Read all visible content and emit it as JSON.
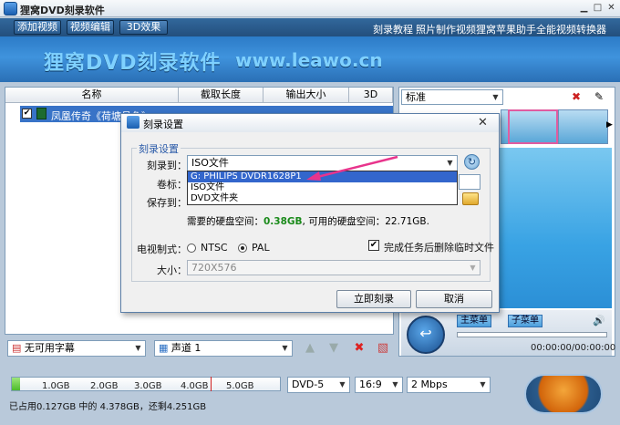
{
  "window": {
    "title": "狸窝DVD刻录软件"
  },
  "toolbar": {
    "add_video": "添加视频",
    "edit_video": "视频编辑",
    "effect_3d": "3D效果",
    "links": [
      "刻录教程",
      "照片制作视频",
      "狸窝苹果助手",
      "全能视频转换器"
    ]
  },
  "banner": {
    "title": "狸窝DVD刻录软件",
    "url": "www.leawo.cn"
  },
  "file_table": {
    "columns": [
      "名称",
      "截取长度",
      "输出大小",
      "3D"
    ],
    "rows": [
      {
        "name": "凤凰传奇《荷塘月色》",
        "checked": true
      }
    ]
  },
  "right_panel": {
    "style_label": "标准"
  },
  "player": {
    "main_menu": "主菜单",
    "sub_menu": "子菜单",
    "time": "00:00:00/00:00:00"
  },
  "bottom": {
    "subtitle": "无可用字幕",
    "audio_track": "声道 1",
    "disc_type": "DVD-5",
    "aspect": "16:9",
    "bitrate": "2 Mbps",
    "capacity_ticks": [
      "1.0GB",
      "2.0GB",
      "3.0GB",
      "4.0GB",
      "5.0GB"
    ],
    "usage_text": "已占用0.127GB 中的 4.378GB，还剩4.251GB",
    "used_fraction": 0.029
  },
  "dialog": {
    "title": "刻录设置",
    "group_label": "刻录设置",
    "burn_to_label": "刻录到：",
    "burn_to_value": "ISO文件",
    "volume_label": "卷标：",
    "save_to_label": "保存到：",
    "dropdown_options": [
      "G: PHILIPS  DVDR1628P1",
      "ISO文件",
      "DVD文件夹"
    ],
    "space_prefix": "需要的硬盘空间：",
    "space_needed": "0.38GB",
    "space_mid": ", 可用的硬盘空间：",
    "space_available": "22.71GB.",
    "tv_label": "电视制式：",
    "ntsc": "NTSC",
    "pal": "PAL",
    "tv_selected": "PAL",
    "delete_temp_label": "完成任务后删除临时文件",
    "delete_temp_checked": true,
    "size_label": "大小：",
    "size_value": "720X576",
    "burn_now": "立即刻录",
    "cancel": "取消"
  },
  "colors": {
    "accent": "#3873c7",
    "banner": "#3f93dd",
    "arrow": "#e8348c"
  }
}
